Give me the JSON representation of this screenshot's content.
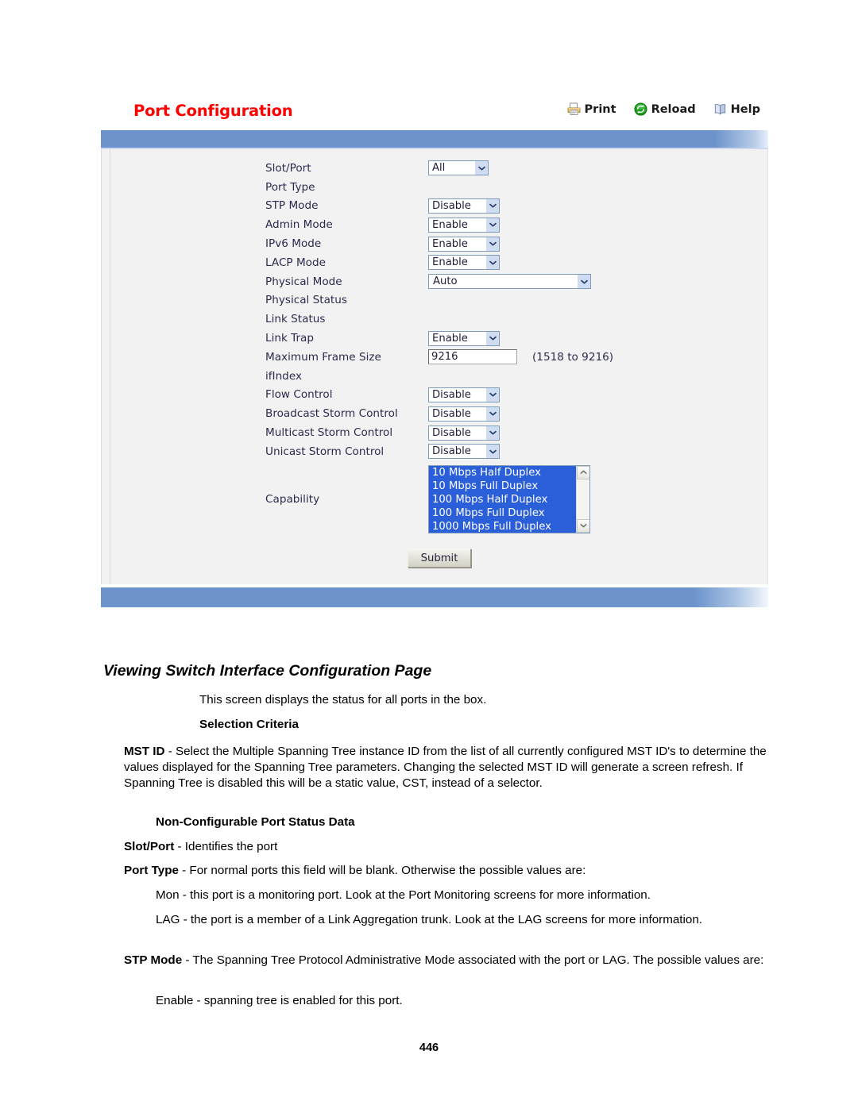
{
  "ui": {
    "title": "Port Configuration",
    "actions": [
      {
        "label": "Print",
        "icon": "printer-icon"
      },
      {
        "label": "Reload",
        "icon": "reload-icon"
      },
      {
        "label": "Help",
        "icon": "help-book-icon"
      }
    ],
    "rows": [
      {
        "label": "Slot/Port",
        "control": "select",
        "value": "All",
        "width": "w-all"
      },
      {
        "label": "Port Type",
        "control": "none",
        "value": ""
      },
      {
        "label": "STP Mode",
        "control": "select",
        "value": "Disable",
        "width": "w-std"
      },
      {
        "label": "Admin Mode",
        "control": "select",
        "value": "Enable",
        "width": "w-std"
      },
      {
        "label": "IPv6 Mode",
        "control": "select",
        "value": "Enable",
        "width": "w-std"
      },
      {
        "label": "LACP Mode",
        "control": "select",
        "value": "Enable",
        "width": "w-std"
      },
      {
        "label": "Physical Mode",
        "control": "select",
        "value": "Auto",
        "width": "w-wide"
      },
      {
        "label": "Physical Status",
        "control": "none",
        "value": ""
      },
      {
        "label": "Link Status",
        "control": "none",
        "value": ""
      },
      {
        "label": "Link Trap",
        "control": "select",
        "value": "Enable",
        "width": "w-std"
      },
      {
        "label": "Maximum Frame Size",
        "control": "text",
        "value": "9216",
        "hint": "(1518 to 9216)"
      },
      {
        "label": "ifIndex",
        "control": "none",
        "value": ""
      },
      {
        "label": "Flow Control",
        "control": "select",
        "value": "Disable",
        "width": "w-std"
      },
      {
        "label": "Broadcast Storm Control",
        "control": "select",
        "value": "Disable",
        "width": "w-std"
      },
      {
        "label": "Multicast Storm Control",
        "control": "select",
        "value": "Disable",
        "width": "w-std"
      },
      {
        "label": "Unicast Storm Control",
        "control": "select",
        "value": "Disable",
        "width": "w-std"
      }
    ],
    "capability": {
      "label": "Capability",
      "options": [
        "10 Mbps Half Duplex",
        "10 Mbps Full Duplex",
        "100 Mbps Half Duplex",
        "100 Mbps Full Duplex",
        "1000 Mbps Full Duplex"
      ],
      "selected_all": true
    },
    "submit_label": "Submit",
    "colors": {
      "title_red": "#ff0000",
      "bar_blue": "#6d93cd",
      "listbox_selected_blue": "#2b5fd9",
      "body_gray": "#f2f2f2"
    }
  },
  "doc": {
    "heading": "Viewing Switch Interface Configuration Page",
    "intro": "This screen displays the status for all ports in the box.",
    "selection_criteria_heading": "Selection Criteria",
    "mst_id_term": "MST ID",
    "mst_id_body": " - Select the Multiple Spanning Tree instance ID from the list of all currently configured MST ID's to determine the values displayed for the Spanning Tree parameters. Changing the selected MST ID will generate a screen refresh. If Spanning Tree is disabled this will be a static value, CST, instead of a selector.",
    "nonconfig_heading": "Non-Configurable Port Status Data",
    "slot_port_term": "Slot/Port",
    "slot_port_body": " - Identifies the port",
    "port_type_term": "Port Type",
    "port_type_body": " - For normal ports this field will be blank. Otherwise the possible values are:",
    "mon_text": "Mon - this port is a monitoring port. Look at the Port Monitoring screens for more information.",
    "lag_text": "LAG - the port is a member of a Link Aggregation trunk. Look at the LAG screens for more information.",
    "stp_mode_term": "STP Mode",
    "stp_mode_body": " - The Spanning Tree Protocol Administrative Mode associated with the port or LAG. The possible values are:",
    "enable_text": "Enable - spanning tree is enabled for this port.",
    "page_number": "446"
  }
}
